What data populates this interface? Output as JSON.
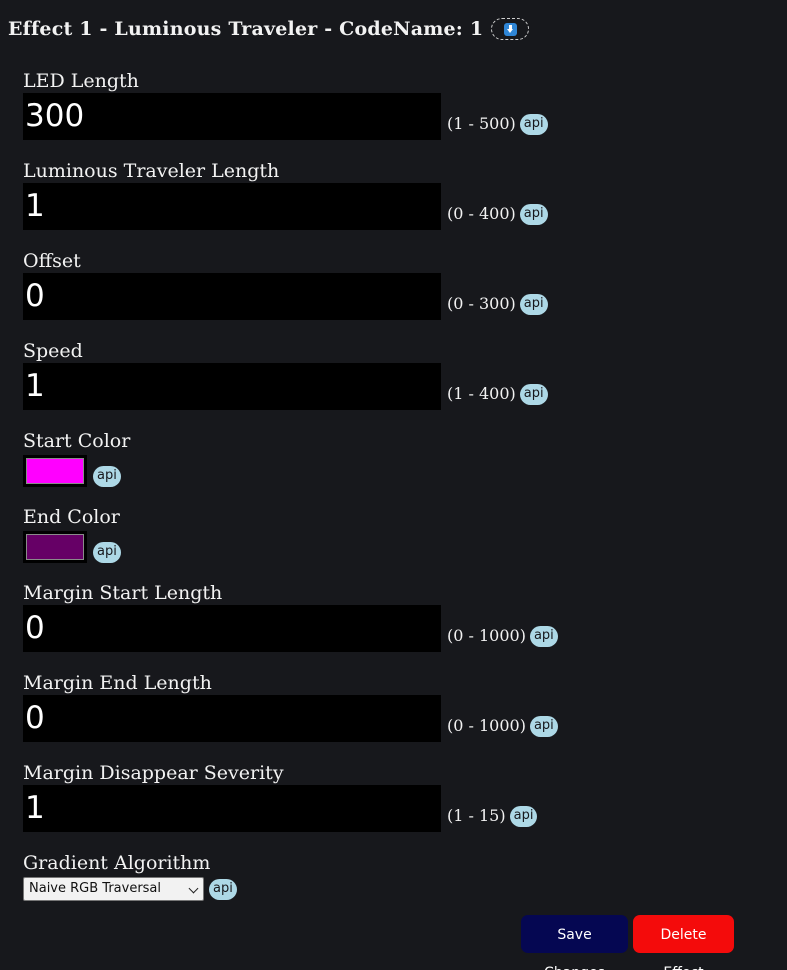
{
  "header": {
    "title": "Effect 1 - Luminous Traveler - CodeName: 1"
  },
  "fields": [
    {
      "label": "LED Length",
      "value": "300",
      "range": "(1 - 500)",
      "api": "api"
    },
    {
      "label": "Luminous Traveler Length",
      "value": "1",
      "range": "(0 - 400)",
      "api": "api"
    },
    {
      "label": "Offset",
      "value": "0",
      "range": "(0 - 300)",
      "api": "api"
    },
    {
      "label": "Speed",
      "value": "1",
      "range": "(1 - 400)",
      "api": "api"
    },
    {
      "label": "Start Color",
      "color": "#ff00ff",
      "api": "api"
    },
    {
      "label": "End Color",
      "color": "#660066",
      "api": "api"
    },
    {
      "label": "Margin Start Length",
      "value": "0",
      "range": "(0 - 1000)",
      "api": "api"
    },
    {
      "label": "Margin End Length",
      "value": "0",
      "range": "(0 - 1000)",
      "api": "api"
    },
    {
      "label": "Margin Disappear Severity",
      "value": "1",
      "range": "(1 - 15)",
      "api": "api"
    },
    {
      "label": "Gradient Algorithm",
      "selected": "Naive RGB Traversal",
      "api": "api"
    }
  ],
  "actions": {
    "save_label": "Save Changes",
    "delete_label": "Delete Effect"
  },
  "colors": {
    "background": "#17181c",
    "input_background": "#000000",
    "api_badge": "#add8e6",
    "save_button": "#050752",
    "delete_button": "#f40b0b"
  }
}
